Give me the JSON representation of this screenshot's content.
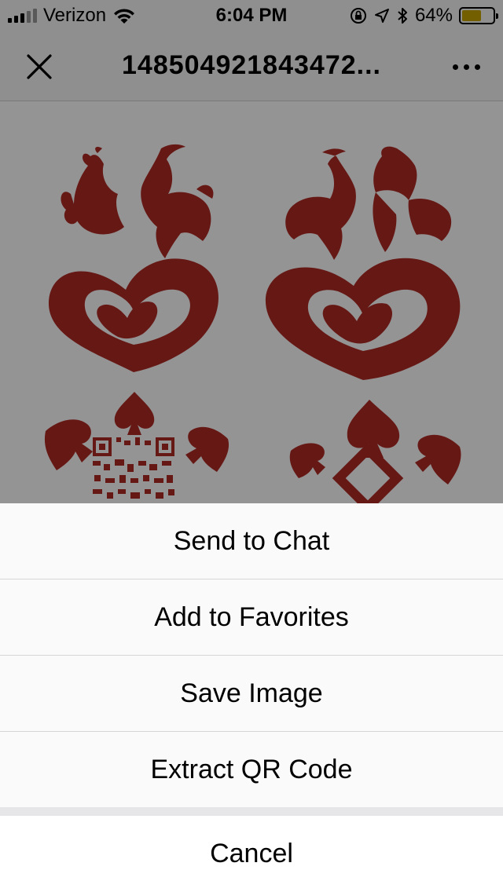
{
  "status_bar": {
    "carrier": "Verizon",
    "time": "6:04 PM",
    "battery_percent": "64%",
    "battery_level": 0.64,
    "icons": [
      "signal-icon",
      "wifi-icon",
      "orientation-lock-icon",
      "location-icon",
      "bluetooth-icon",
      "battery-icon"
    ],
    "battery_color": "#c8a400"
  },
  "nav": {
    "title": "148504921843472...",
    "close_icon": "close-icon",
    "more_icon": "more-icon"
  },
  "image": {
    "accent_color": "#b02a25"
  },
  "action_sheet": {
    "items": [
      {
        "label": "Send to Chat"
      },
      {
        "label": "Add to Favorites"
      },
      {
        "label": "Save Image"
      },
      {
        "label": "Extract QR Code"
      }
    ],
    "cancel_label": "Cancel"
  }
}
